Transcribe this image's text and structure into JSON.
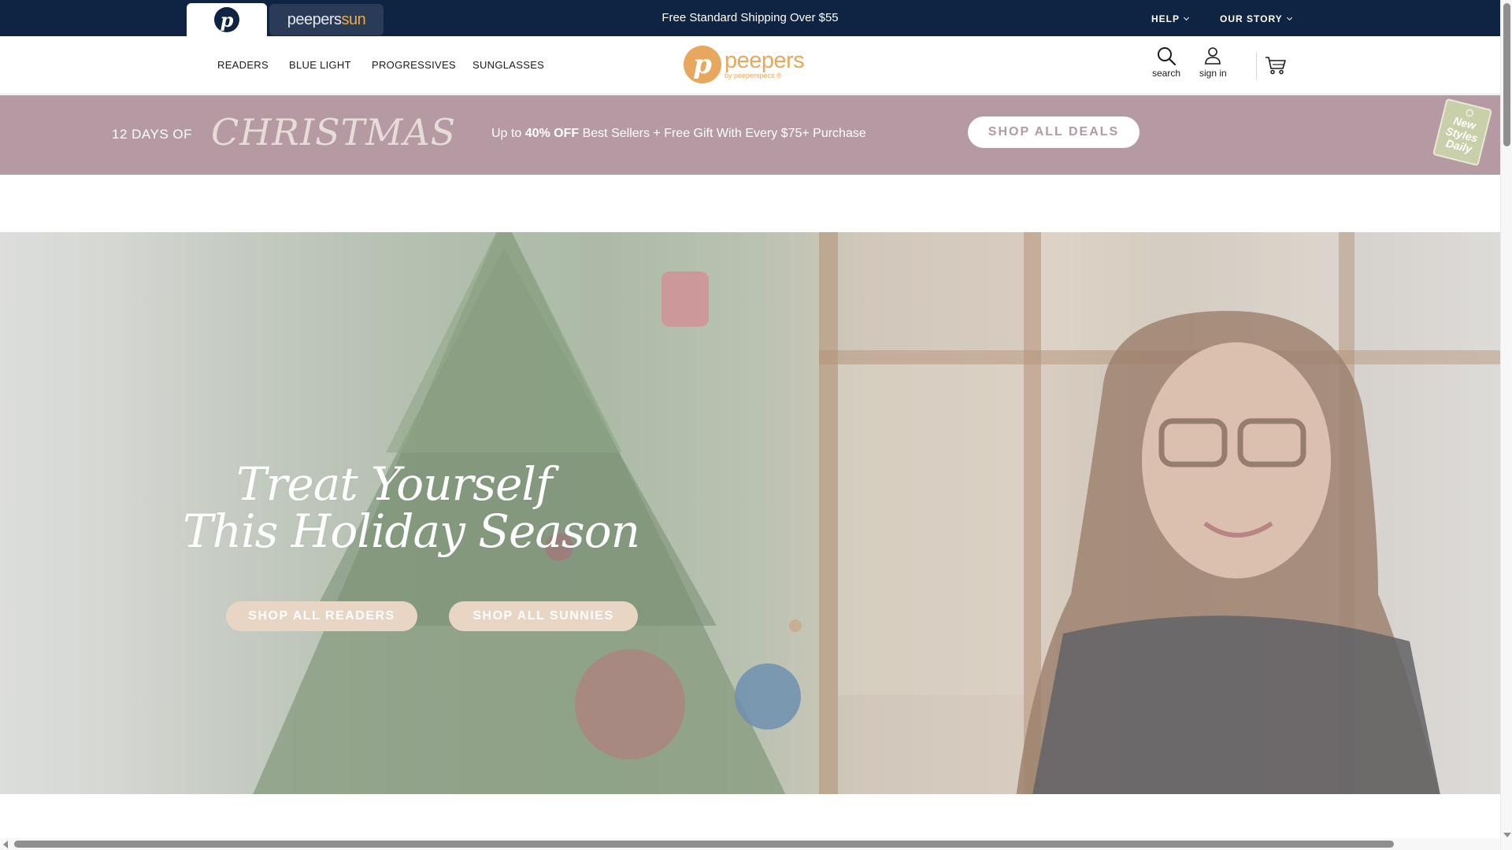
{
  "topbar": {
    "tabs": [
      {
        "label": "p"
      },
      {
        "label_a": "peepers",
        "label_b": "sun"
      }
    ],
    "shipping": "Free Standard Shipping Over $55",
    "help": "HELP",
    "our_story": "OUR STORY"
  },
  "nav": {
    "items": [
      "READERS",
      "BLUE LIGHT",
      "PROGRESSIVES",
      "SUNGLASSES"
    ],
    "logo": {
      "mark": "p",
      "word": "peepers",
      "sub": "by peeperspecs ®"
    },
    "search": "search",
    "sign_in": "sign in"
  },
  "promo": {
    "days": "12 DAYS OF",
    "christmas": "CHRISTMAS",
    "msg_pre": "Up to ",
    "msg_bold": "40% OFF",
    "msg_post": " Best Sellers + Free Gift With Every $75+ Purchase",
    "button": "SHOP ALL DEALS",
    "tag_lines": [
      "New",
      "Styles",
      "Daily"
    ]
  },
  "hero": {
    "title_line1": "Treat Yourself",
    "title_line2": "This Holiday Season",
    "btn_readers": "SHOP ALL READERS",
    "btn_sunnies": "SHOP ALL SUNNIES"
  },
  "colors": {
    "topbar": "#0f2342",
    "brand_orange": "#e7a75e",
    "promo_bg": "#b69aa3",
    "hero_button": "#e9d5c3"
  }
}
